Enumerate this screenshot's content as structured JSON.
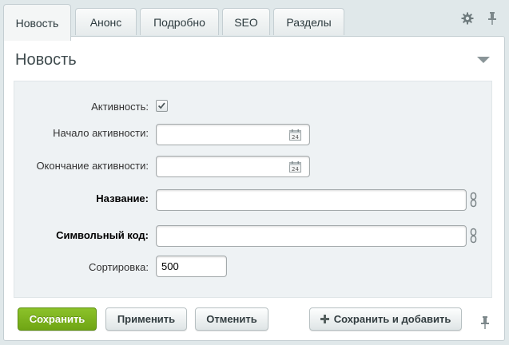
{
  "tabs": [
    {
      "label": "Новость",
      "active": true
    },
    {
      "label": "Анонс",
      "active": false
    },
    {
      "label": "Подробно",
      "active": false
    },
    {
      "label": "SEO",
      "active": false
    },
    {
      "label": "Разделы",
      "active": false
    }
  ],
  "toolbar_icons": {
    "settings": "gear-icon",
    "pin": "pin-icon"
  },
  "section": {
    "title": "Новость"
  },
  "form": {
    "active_label": "Активность:",
    "active_checked": true,
    "active_from_label": "Начало активности:",
    "active_from_value": "",
    "active_to_label": "Окончание активности:",
    "active_to_value": "",
    "name_label": "Название:",
    "name_value": "",
    "code_label": "Символьный код:",
    "code_value": "",
    "sort_label": "Сортировка:",
    "sort_value": "500",
    "calendar_day": "24"
  },
  "buttons": {
    "save": "Сохранить",
    "apply": "Применить",
    "cancel": "Отменить",
    "save_add": "Сохранить и добавить"
  },
  "colors": {
    "primary_button": "#7ab51d",
    "background": "#e0e8ea",
    "form_area": "#eef2f4"
  }
}
